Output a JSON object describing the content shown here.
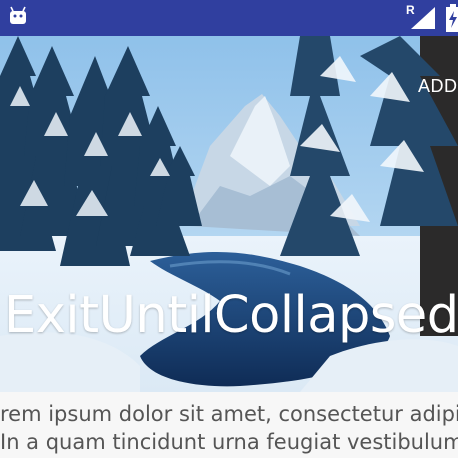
{
  "status_bar": {
    "network_label": "R",
    "icons": [
      "android-icon",
      "signal-icon",
      "battery-icon"
    ]
  },
  "toolbar": {
    "action_label": "ADD"
  },
  "header": {
    "title": "ExitUntilCollapsed",
    "image_icon": "winter-landscape-image"
  },
  "content": {
    "lines": [
      "rem ipsum dolor sit amet, consectetur adipiscing",
      "In a quam tincidunt urna feugiat vestibulum"
    ]
  },
  "colors": {
    "status_bar": "#303f9f",
    "content_background": "#f7f7f7",
    "body_text": "#555555"
  }
}
